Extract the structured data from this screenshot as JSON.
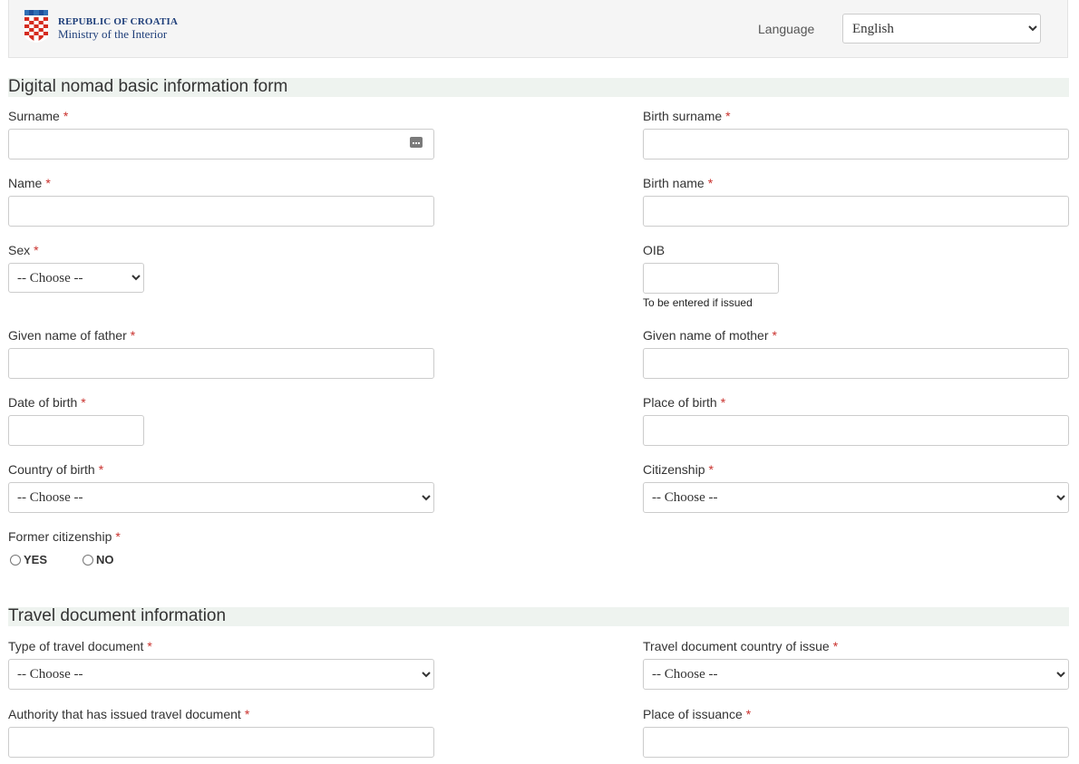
{
  "header": {
    "logo_line1": "REPUBLIC OF CROATIA",
    "logo_line2": "Ministry of the Interior",
    "language_label": "Language",
    "language_value": "English"
  },
  "sections": {
    "basic": "Digital nomad basic information form",
    "travel": "Travel document information"
  },
  "fields": {
    "surname": "Surname",
    "birth_surname": "Birth surname",
    "name": "Name",
    "birth_name": "Birth name",
    "sex": "Sex",
    "oib": "OIB",
    "oib_help": "To be entered if issued",
    "father": "Given name of father",
    "mother": "Given name of mother",
    "dob": "Date of birth",
    "place_of_birth": "Place of birth",
    "country_of_birth": "Country of birth",
    "citizenship": "Citizenship",
    "former_citizenship": "Former citizenship",
    "yes": "YES",
    "no": "NO",
    "doc_type": "Type of travel document",
    "doc_country": "Travel document country of issue",
    "authority": "Authority that has issued travel document",
    "place_of_issuance": "Place of issuance"
  },
  "required_mark": "*",
  "choose_option": "-- Choose --"
}
